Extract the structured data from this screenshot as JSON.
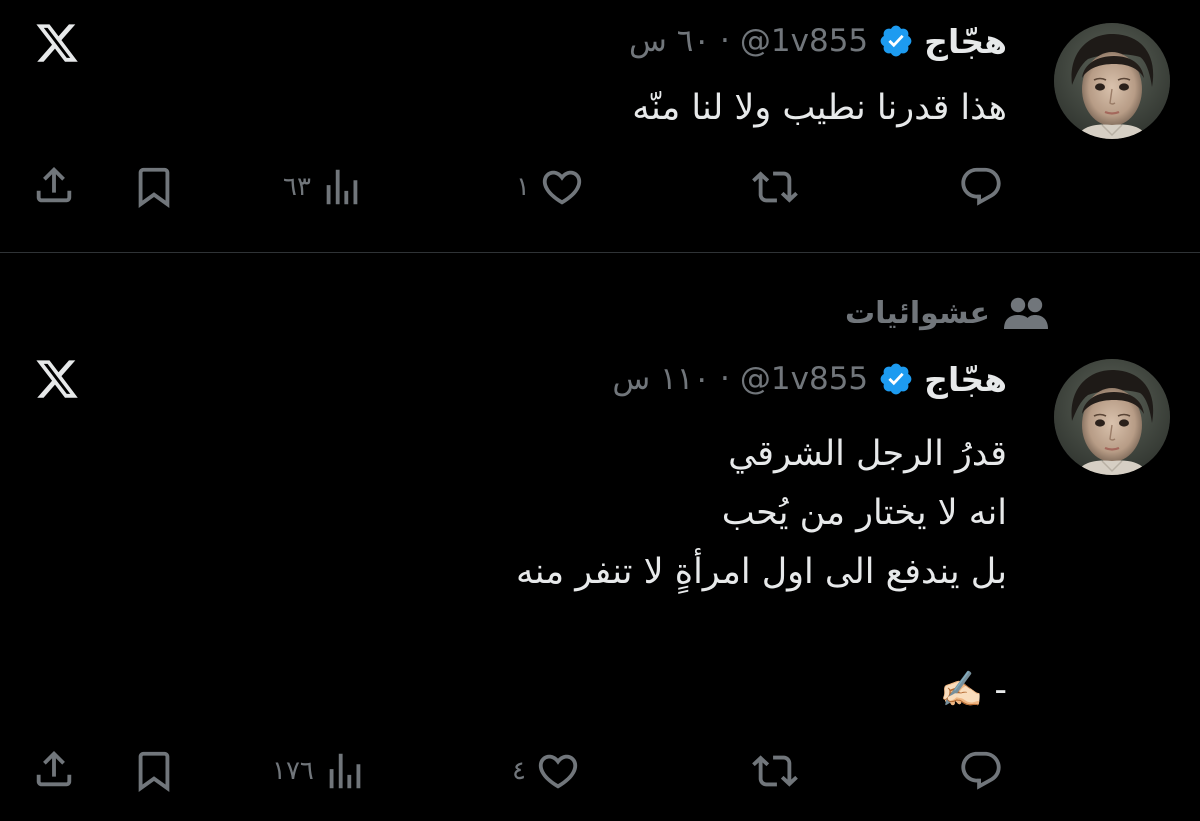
{
  "tweets": [
    {
      "author": {
        "name": "هجّاج",
        "handle": "@1v855",
        "verified": true,
        "avatar_icon": "portrait-avatar"
      },
      "separator": "·",
      "time": "٦٠ س",
      "text_lines": [
        "هذا قدرنا نطيب ولا لنا منّه"
      ],
      "actions": {
        "reply_count": "",
        "retweet_count": "",
        "like_count": "١",
        "views_count": "٦٣"
      }
    },
    {
      "community": {
        "label": "عشوائيات",
        "icon": "community-icon"
      },
      "author": {
        "name": "هجّاج",
        "handle": "@1v855",
        "verified": true,
        "avatar_icon": "portrait-avatar"
      },
      "separator": "·",
      "time": "١١٠ س",
      "text_lines": [
        "قدرُ الرجل الشرقي",
        "انه لا يختار من يُحب",
        "بل يندفع الى اول امرأةٍ لا تنفر منه",
        "",
        "- ✍🏻"
      ],
      "actions": {
        "reply_count": "",
        "retweet_count": "",
        "like_count": "٤",
        "views_count": "١٧٦"
      }
    }
  ],
  "colors": {
    "background": "#000000",
    "text_primary": "#e7e9ea",
    "text_secondary": "#71767b",
    "verified_badge": "#1d9bf0",
    "divider": "#2f3336"
  },
  "icons": [
    "x-logo-icon",
    "verified-badge-icon",
    "reply-icon",
    "retweet-icon",
    "like-icon",
    "views-icon",
    "bookmark-icon",
    "share-icon"
  ]
}
